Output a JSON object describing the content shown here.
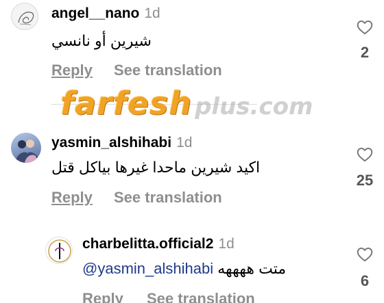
{
  "comments": [
    {
      "username": "angel__nano",
      "time": "1d",
      "text": "شيرين  أو نانسي",
      "reply_label": "Reply",
      "translation_label": "See translation",
      "likes": "2"
    },
    {
      "username": "yasmin_alshihabi",
      "time": "1d",
      "text": "اكيد شيرين ماحدا غيرها بياكل قتل",
      "reply_label": "Reply",
      "translation_label": "See translation",
      "likes": "25"
    },
    {
      "username": "charbelitta.official2",
      "time": "1d",
      "mention": "@yasmin_alshihabi",
      "text": "متت ههههه",
      "reply_label": "Reply",
      "translation_label": "See translation",
      "likes": "6"
    }
  ],
  "watermark": {
    "main": "farfesh",
    "sub": "plus.com"
  },
  "colors": {
    "secondary_text": "#8e8e8e",
    "mention": "#1f3a8a",
    "watermark": "#f2a325"
  },
  "icons": {
    "avatar_1": "sketch-avatar-icon",
    "avatar_2": "photo-avatar-icon",
    "avatar_3": "logo-avatar-icon",
    "like": "heart-outline-icon"
  }
}
